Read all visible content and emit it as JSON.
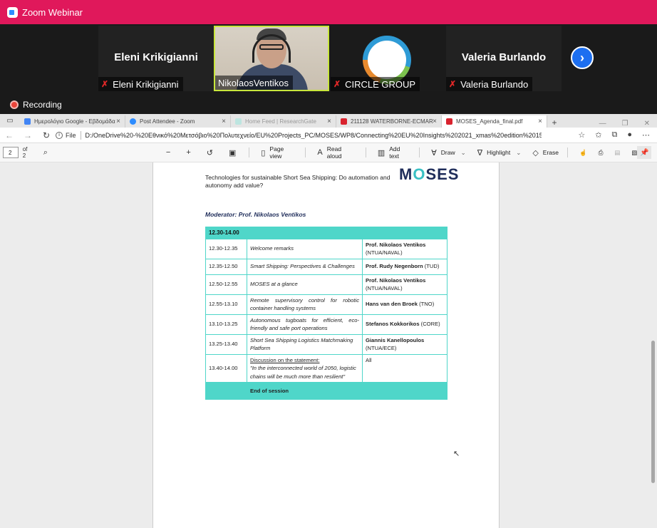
{
  "zoom": {
    "title": "Zoom Webinar",
    "participants": [
      {
        "display_name": "Eleni Krikigianni",
        "label": "Eleni Krikigianni"
      },
      {
        "label": "NikolaosVentikos"
      },
      {
        "label": "CIRCLE GROUP"
      },
      {
        "display_name": "Valeria Burlando",
        "label": "Valeria Burlando"
      }
    ],
    "recording": "Recording"
  },
  "browser": {
    "tabs": [
      {
        "title": "Ημερολόγιο Google - Εβδομάδα"
      },
      {
        "title": "Post Attendee - Zoom"
      },
      {
        "title": "Home Feed | ResearchGate"
      },
      {
        "title": "211128 WATERBORNE-ECMAR"
      },
      {
        "title": "MOSES_Agenda_final.pdf"
      }
    ],
    "file_label": "File",
    "url": "D:/OneDrive%20-%20Εθνικό%20Μετσόβιο%20Πολυτεχνείο/EU%20Projects_PC/MOSES/WP8/Connecting%20EU%20Insights%202021_xmas%20edition%2015%20Dec..."
  },
  "pdf_toolbar": {
    "page": "2",
    "of_pages": "of 2",
    "page_view": "Page view",
    "read_aloud": "Read aloud",
    "add_text": "Add text",
    "draw": "Draw",
    "highlight": "Highlight",
    "erase": "Erase"
  },
  "document": {
    "title": "Technologies for sustainable Short Sea Shipping: Do automation and autonomy add value?",
    "logo_pre": "M",
    "logo_o": "O",
    "logo_post": "SES",
    "moderator": "Moderator: Prof. Nikolaos Ventikos",
    "session_time": "12.30-14.00",
    "rows": [
      {
        "time": "12.30-12.35",
        "talk": "Welcome remarks",
        "speaker": "Prof. Nikolaos Ventikos",
        "affil": "(NTUA/NAVAL)"
      },
      {
        "time": "12.35-12.50",
        "talk": "Smart Shipping: Perspectives & Challenges",
        "speaker": "Prof. Rudy Negenborn",
        "affil": "(TUD)"
      },
      {
        "time": "12.50-12.55",
        "talk": "MOSES at a glance",
        "speaker": "Prof. Nikolaos Ventikos",
        "affil": "(NTUA/NAVAL)"
      },
      {
        "time": "12.55-13.10",
        "talk": "Remote supervisory control for robotic container handling systems",
        "speaker": "Hans van den Broek",
        "affil": "(TNO)"
      },
      {
        "time": "13.10-13.25",
        "talk": "Autonomous tugboats for efficient, eco-friendly and safe port operations",
        "speaker": "Stefanos Kokkorikos",
        "affil": "(CORE)"
      },
      {
        "time": "13.25-13.40",
        "talk": "Short Sea Shipping Logistics Matchmaking Platform",
        "speaker": "Giannis Kanellopoulos",
        "affil": "(NTUA/ECE)"
      }
    ],
    "discussion": {
      "time": "13.40-14.00",
      "heading": "Discussion on the statement:",
      "statement": "\"In the interconnected world of 2050, logistic chains will be much more than resilient\"",
      "speaker": "All"
    },
    "end": "End of session"
  }
}
